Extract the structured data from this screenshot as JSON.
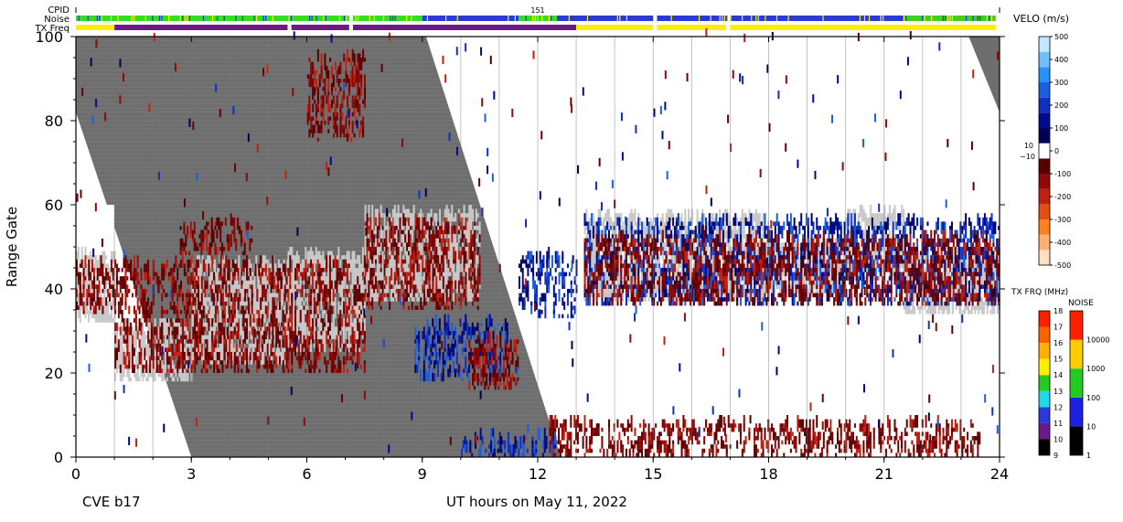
{
  "chart_data": {
    "type": "heatmap",
    "title": "",
    "xlabel": "UT hours on May 11, 2022",
    "ylabel": "Range Gate",
    "station_label": "CVE b17",
    "xlim": [
      0,
      24
    ],
    "ylim": [
      0,
      100
    ],
    "x_ticks": [
      "0",
      "3",
      "6",
      "9",
      "12",
      "15",
      "18",
      "21",
      "24"
    ],
    "y_ticks": [
      "0",
      "20",
      "40",
      "60",
      "80",
      "100"
    ],
    "cpid": "151",
    "strip_labels": [
      "CPID",
      "Noise",
      "TX Freq"
    ],
    "noise_strip_segments": [
      {
        "t0": 0.0,
        "t1": 7.1,
        "color": "#33dd22"
      },
      {
        "t0": 7.2,
        "t1": 9.0,
        "color": "#33dd22"
      },
      {
        "t0": 9.0,
        "t1": 11.5,
        "color": "#2a3ad8"
      },
      {
        "t0": 11.5,
        "t1": 12.5,
        "color": "#33dd22"
      },
      {
        "t0": 12.5,
        "t1": 15.0,
        "color": "#2a3ad8"
      },
      {
        "t0": 15.1,
        "t1": 16.9,
        "color": "#2a3ad8"
      },
      {
        "t0": 17.0,
        "t1": 21.5,
        "color": "#2a3ad8"
      },
      {
        "t0": 21.5,
        "t1": 23.9,
        "color": "#44cc22"
      }
    ],
    "tx_freq_strip_segments": [
      {
        "t0": 0.0,
        "t1": 1.0,
        "color": "#ffee00"
      },
      {
        "t0": 1.0,
        "t1": 5.5,
        "color": "#6a1a8a"
      },
      {
        "t0": 5.6,
        "t1": 7.1,
        "color": "#6a1a8a"
      },
      {
        "t0": 7.2,
        "t1": 13.0,
        "color": "#6a1a8a"
      },
      {
        "t0": 13.0,
        "t1": 15.0,
        "color": "#ffee00"
      },
      {
        "t0": 15.1,
        "t1": 16.9,
        "color": "#ffee00"
      },
      {
        "t0": 17.0,
        "t1": 23.9,
        "color": "#ffee00"
      }
    ],
    "ground_scatter_color": "#c8c8c8",
    "no_data_color": "#6e6e6e",
    "velocity_scale": {
      "title": "VELO (m/s)",
      "ticks": [
        "500",
        "400",
        "300",
        "200",
        "100",
        "0",
        "-100",
        "-200",
        "-300",
        "-400",
        "-500"
      ],
      "zero_band_labels": [
        "10",
        "−10"
      ],
      "range": [
        -500,
        500
      ],
      "colors": [
        "#ffe0c0",
        "#ffb070",
        "#ff8020",
        "#e05010",
        "#c02010",
        "#900808",
        "#5a0000",
        "#ffffff",
        "#00005a",
        "#000a90",
        "#1030c0",
        "#1860e0",
        "#2890ff",
        "#70c0ff",
        "#c0e8ff"
      ]
    },
    "tx_freq_scale": {
      "title": "TX FRQ (MHz)",
      "ticks": [
        "9",
        "10",
        "11",
        "12",
        "13",
        "14",
        "15",
        "16",
        "17",
        "18"
      ],
      "colors": [
        "#000000",
        "#6a1a8a",
        "#2a3ad8",
        "#20d8e8",
        "#22cc22",
        "#ffee00",
        "#ffb000",
        "#ff6000",
        "#ff2000"
      ]
    },
    "noise_scale": {
      "title": "NOISE",
      "ticks": [
        "1",
        "10",
        "100",
        "1000",
        "10000"
      ],
      "colors": [
        "#000000",
        "#2020e0",
        "#22cc22",
        "#ffcc00",
        "#ff2000"
      ]
    },
    "echo_regions": [
      {
        "kind": "ground",
        "t0": 0.0,
        "t1": 1.0,
        "g0": 32,
        "g1": 48
      },
      {
        "kind": "ground",
        "t0": 1.0,
        "t1": 3.0,
        "g0": 18,
        "g1": 31
      },
      {
        "kind": "ground",
        "t0": 3.0,
        "t1": 5.5,
        "g0": 22,
        "g1": 46
      },
      {
        "kind": "ground",
        "t0": 5.5,
        "t1": 7.5,
        "g0": 25,
        "g1": 48
      },
      {
        "kind": "ground",
        "t0": 7.5,
        "t1": 10.5,
        "g0": 37,
        "g1": 58
      },
      {
        "kind": "ground",
        "t0": 13.2,
        "t1": 18.0,
        "g0": 37,
        "g1": 57
      },
      {
        "kind": "ground",
        "t0": 18.0,
        "t1": 20.0,
        "g0": 38,
        "g1": 50
      },
      {
        "kind": "ground",
        "t0": 20.0,
        "t1": 21.5,
        "g0": 42,
        "g1": 58
      },
      {
        "kind": "ground",
        "t0": 21.5,
        "t1": 24.0,
        "g0": 34,
        "g1": 48
      },
      {
        "kind": "away",
        "t0": 0.0,
        "t1": 1.0,
        "g0": 34,
        "g1": 46
      },
      {
        "kind": "away",
        "t0": 1.0,
        "t1": 7.5,
        "g0": 20,
        "g1": 46
      },
      {
        "kind": "away",
        "t0": 7.5,
        "t1": 10.5,
        "g0": 35,
        "g1": 56
      },
      {
        "kind": "away",
        "t0": 2.7,
        "t1": 4.6,
        "g0": 48,
        "g1": 56
      },
      {
        "kind": "away",
        "t0": 6.0,
        "t1": 7.5,
        "g0": 75,
        "g1": 95
      },
      {
        "kind": "toward",
        "t0": 8.8,
        "t1": 11.2,
        "g0": 18,
        "g1": 32
      },
      {
        "kind": "toward",
        "t0": 11.5,
        "t1": 13.0,
        "g0": 33,
        "g1": 48
      },
      {
        "kind": "away",
        "t0": 10.2,
        "t1": 11.5,
        "g0": 16,
        "g1": 28
      },
      {
        "kind": "away",
        "t0": 12.3,
        "t1": 23.5,
        "g0": 0,
        "g1": 8
      },
      {
        "kind": "toward",
        "t0": 13.2,
        "t1": 24.0,
        "g0": 36,
        "g1": 56
      },
      {
        "kind": "away",
        "t0": 13.2,
        "t1": 24.0,
        "g0": 36,
        "g1": 52
      },
      {
        "kind": "toward",
        "t0": 10.0,
        "t1": 12.5,
        "g0": 0,
        "g1": 5
      }
    ]
  }
}
